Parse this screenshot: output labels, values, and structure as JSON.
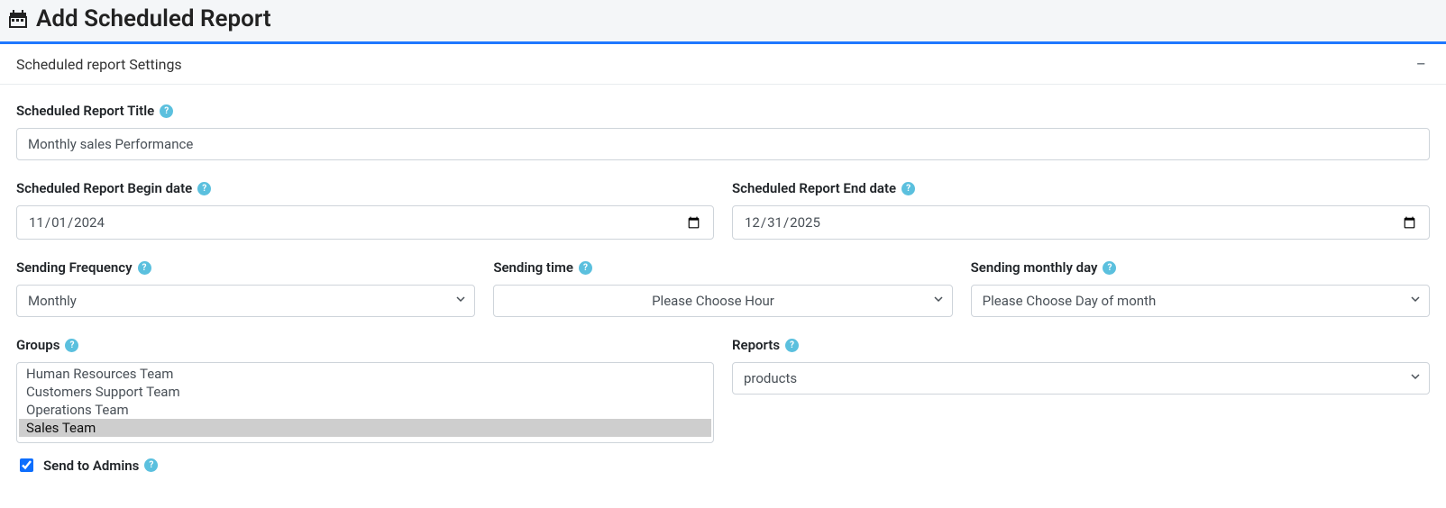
{
  "header": {
    "title": "Add Scheduled Report"
  },
  "section": {
    "title": "Scheduled report Settings"
  },
  "fields": {
    "report_title": {
      "label": "Scheduled Report Title",
      "value": "Monthly sales Performance"
    },
    "begin_date": {
      "label": "Scheduled Report Begin date",
      "value": "2024-11-01"
    },
    "end_date": {
      "label": "Scheduled Report End date",
      "value": "2025-12-31"
    },
    "frequency": {
      "label": "Sending Frequency",
      "selected": "Monthly"
    },
    "sending_time": {
      "label": "Sending time",
      "placeholder": "Please Choose Hour"
    },
    "monthly_day": {
      "label": "Sending monthly day",
      "placeholder": "Please Choose Day of month"
    },
    "groups": {
      "label": "Groups",
      "options": [
        "Human Resources Team",
        "Customers Support Team",
        "Operations Team",
        "Sales Team"
      ],
      "selected": "Sales Team"
    },
    "reports": {
      "label": "Reports",
      "selected": "products"
    },
    "send_admins": {
      "label": "Send to Admins"
    }
  },
  "icons": {
    "help": "?"
  }
}
